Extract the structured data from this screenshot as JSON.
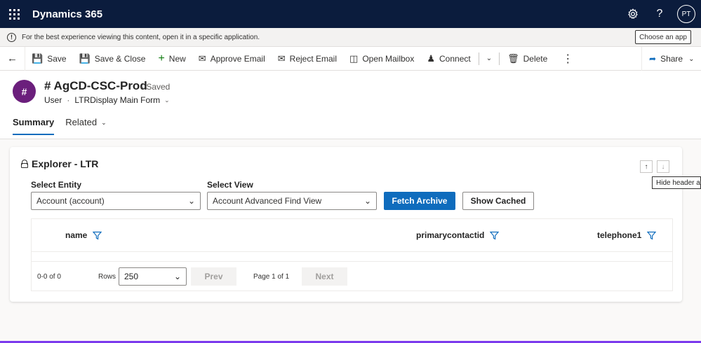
{
  "topbar": {
    "app_title": "Dynamics 365",
    "avatar_initials": "PT",
    "help_label": "?"
  },
  "notification": {
    "message": "For the best experience viewing this content, open it in a specific application.",
    "choose_app_label": "Choose an app"
  },
  "commands": {
    "save": "Save",
    "save_close": "Save & Close",
    "new": "New",
    "approve_email": "Approve Email",
    "reject_email": "Reject Email",
    "open_mailbox": "Open Mailbox",
    "connect": "Connect",
    "delete": "Delete",
    "share": "Share"
  },
  "record": {
    "icon_letter": "#",
    "title": "# AgCD-CSC-Prod",
    "status": "- Saved",
    "entity": "User",
    "form_name": "LTRDisplay Main Form"
  },
  "tabs": [
    {
      "label": "Summary",
      "active": true
    },
    {
      "label": "Related",
      "active": false
    }
  ],
  "explorer": {
    "title": "Explorer - LTR",
    "entity_label": "Select Entity",
    "entity_value": "Account (account)",
    "view_label": "Select View",
    "view_value": "Account Advanced Find View",
    "fetch_label": "Fetch Archive",
    "cached_label": "Show Cached",
    "tooltip": "Hide header and",
    "columns": [
      "name",
      "primarycontactid",
      "telephone1"
    ],
    "footer": {
      "range": "0-0 of 0",
      "rows_label": "Rows",
      "rows_value": "250",
      "prev_label": "Prev",
      "page_info": "Page 1 of 1",
      "next_label": "Next"
    }
  },
  "colors": {
    "topbar_bg": "#0b1c3d",
    "accent": "#0f6cbd",
    "record_icon_bg": "#6b1f7c"
  }
}
